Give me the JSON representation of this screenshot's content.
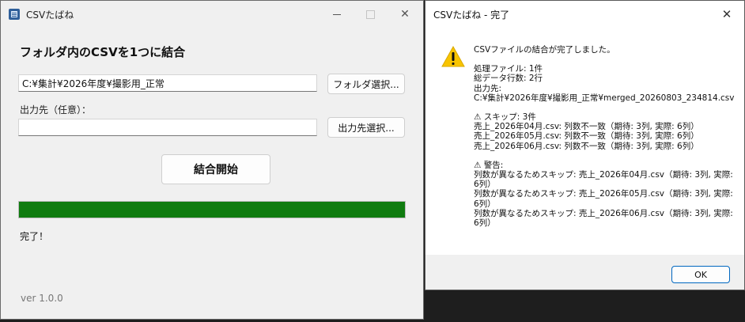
{
  "main_window": {
    "title": "CSVたばね",
    "heading": "フォルダ内のCSVを1つに結合",
    "folder_path": "C:¥集計¥2026年度¥撮影用_正常",
    "folder_button": "フォルダ選択...",
    "output_label": "出力先（任意）：",
    "output_value": "",
    "output_button": "出力先選択...",
    "start_button": "結合開始",
    "progress": 1.0,
    "status": "完了！",
    "version": "ver 1.0.0",
    "colors": {
      "progress": "#107c10"
    }
  },
  "dialog": {
    "title": "CSVたばね - 完了",
    "icon": "warning-icon",
    "message": {
      "line1": "CSVファイルの結合が完了しました。",
      "processed": "処理ファイル: 1件",
      "total_rows": "総データ行数: 2行",
      "output_label": "出力先:",
      "output_path": "C:¥集計¥2026年度¥撮影用_正常¥merged_20260803_234814.csv",
      "skip_header": "⚠ スキップ: 3件",
      "skips": [
        "売上_2026年04月.csv: 列数不一致（期待: 3列, 実際: 6列）",
        "売上_2026年05月.csv: 列数不一致（期待: 3列, 実際: 6列）",
        "売上_2026年06月.csv: 列数不一致（期待: 3列, 実際: 6列）"
      ],
      "warn_header": "⚠ 警告:",
      "warnings": [
        "列数が異なるためスキップ: 売上_2026年04月.csv（期待: 3列, 実際: 6列）",
        "列数が異なるためスキップ: 売上_2026年05月.csv（期待: 3列, 実際: 6列）",
        "列数が異なるためスキップ: 売上_2026年06月.csv（期待: 3列, 実際: 6列）"
      ]
    },
    "ok_button": "OK"
  }
}
